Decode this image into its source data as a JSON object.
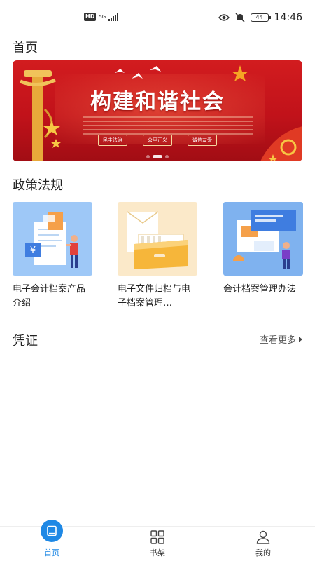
{
  "status_bar": {
    "hd": "HD",
    "network": "5G",
    "battery": "44",
    "time": "14:46",
    "icons": [
      "eye-icon",
      "mute-icon"
    ]
  },
  "home_title": "首页",
  "banner": {
    "title": "构建和谐社会",
    "tags": [
      "民主法治",
      "公平正义",
      "诚信友爱"
    ],
    "slide_count": 3,
    "active_slide": 2,
    "colors": {
      "background": "#c1121a",
      "accent": "#f5d9a0"
    }
  },
  "policy": {
    "title": "政策法规",
    "items": [
      {
        "caption": "电子会计档案产品介绍",
        "icon": "finance-document-illustration"
      },
      {
        "caption": "电子文件归档与电子档案管理…",
        "icon": "archive-box-illustration"
      },
      {
        "caption": "会计档案管理办法",
        "icon": "dashboard-document-illustration"
      }
    ]
  },
  "voucher": {
    "title": "凭证",
    "more_label": "查看更多"
  },
  "bottom_nav": {
    "items": [
      {
        "label": "首页",
        "icon": "book-icon",
        "active": true
      },
      {
        "label": "书架",
        "icon": "grid-icon",
        "active": false
      },
      {
        "label": "我的",
        "icon": "user-icon",
        "active": false
      }
    ],
    "active_color": "#1e88e5"
  }
}
